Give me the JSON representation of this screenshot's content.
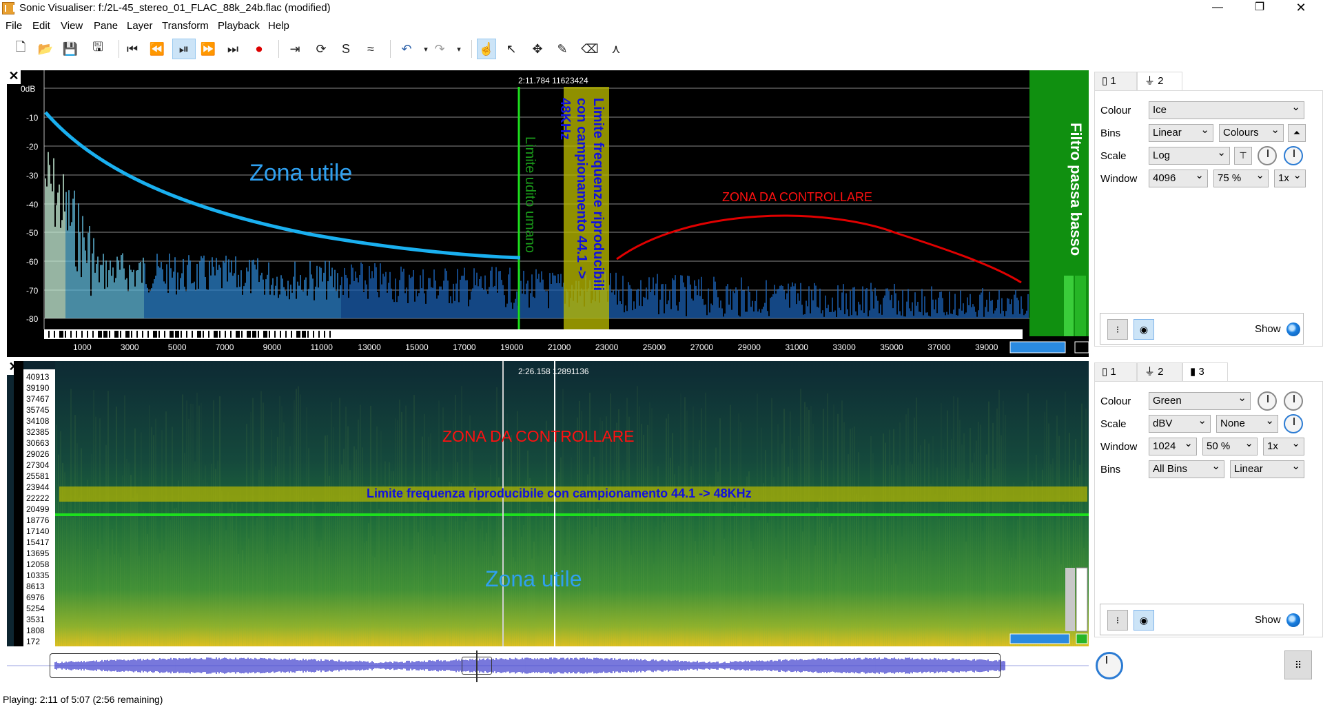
{
  "window": {
    "title": "Sonic Visualiser: f:/2L-45_stereo_01_FLAC_88k_24b.flac (modified)"
  },
  "menu": [
    "File",
    "Edit",
    "View",
    "Pane",
    "Layer",
    "Transform",
    "Playback",
    "Help"
  ],
  "pane1": {
    "cursor_readout": "2:11.784  11623424",
    "db_labels": [
      "0dB",
      "-10",
      "-20",
      "-30",
      "-40",
      "-50",
      "-60",
      "-70",
      "-80"
    ],
    "freq_labels": [
      "1000",
      "3000",
      "5000",
      "7000",
      "9000",
      "11000",
      "13000",
      "15000",
      "17000",
      "19000",
      "21000",
      "23000",
      "25000",
      "27000",
      "29000",
      "31000",
      "33000",
      "35000",
      "37000",
      "39000"
    ],
    "zona_utile": "Zona utile",
    "limite_udito": "Limite udito umano",
    "limite_frequenze": "Limite frequenze riproducibili con campionamento  44.1 -> 48KHz",
    "zona_controllare": "ZONA DA CONTROLLARE",
    "filtro": "Filtro  passa basso"
  },
  "pane2": {
    "cursor_readout": "2:26.158  12891136",
    "bin_labels": [
      "40913",
      "39190",
      "37467",
      "35745",
      "34108",
      "32385",
      "30663",
      "29026",
      "27304",
      "25581",
      "23944",
      "22222",
      "20499",
      "18776",
      "17140",
      "15417",
      "13695",
      "12058",
      "10335",
      "8613",
      "6976",
      "5254",
      "3531",
      "1808",
      "172"
    ],
    "zona_controllare": "ZONA DA CONTROLLARE",
    "limite_frequenza": "Limite frequenza riproducibile con campionamento 44.1 -> 48KHz",
    "zona_utile": "Zona utile"
  },
  "panel1": {
    "tabs": [
      "1",
      "2"
    ],
    "colour_label": "Colour",
    "colour_value": "Ice",
    "bins_label": "Bins",
    "bins_value": "Linear",
    "bins_colours": "Colours",
    "scale_label": "Scale",
    "scale_value": "Log",
    "window_label": "Window",
    "window_value": "4096",
    "window_overlap": "75 %",
    "window_zoom": "1x",
    "show_label": "Show"
  },
  "panel2": {
    "tabs": [
      "1",
      "2",
      "3"
    ],
    "colour_label": "Colour",
    "colour_value": "Green",
    "scale_label": "Scale",
    "scale_value": "dBV",
    "scale_norm": "None",
    "window_label": "Window",
    "window_value": "1024",
    "window_overlap": "50 %",
    "window_zoom": "1x",
    "bins_label": "Bins",
    "bins_value": "All Bins",
    "bins_scale": "Linear",
    "show_label": "Show"
  },
  "status": {
    "text": "Playing: 2:11 of 5:07 (2:56 remaining)"
  },
  "colors": {
    "cyan_curve": "#1ab0f0",
    "green_line": "#1de01d",
    "yellow_band": "#b8b800",
    "red_text": "#ff1010",
    "blue_text": "#1010dd",
    "filter_green": "#109010"
  }
}
